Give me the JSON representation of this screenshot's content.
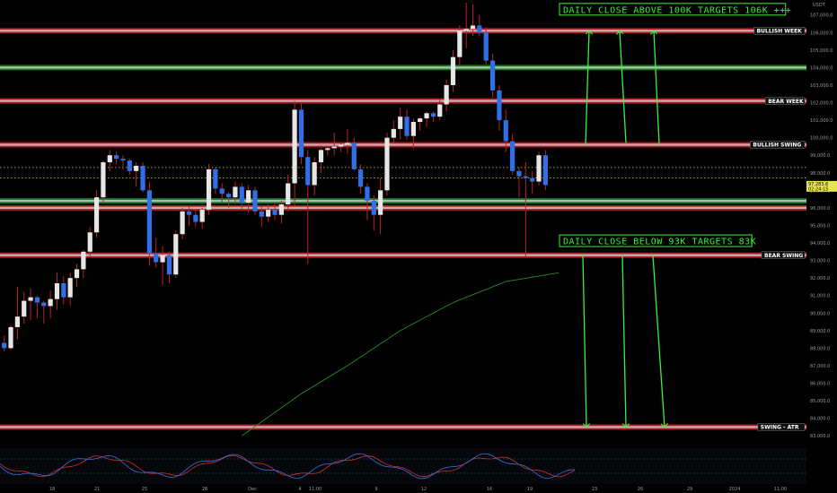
{
  "chart_data": {
    "type": "candlestick",
    "symbol_axis_label": "USDT",
    "colors": {
      "up": "#e6e6e6",
      "down": "#2f6fe8",
      "level_red": "#c8232a",
      "level_green": "#1f8a2a",
      "annotation": "#3cf03c",
      "ma": "#2a8a2a"
    },
    "y_axis": {
      "min": 82500,
      "max": 107700,
      "ticks": [
        83000,
        84000,
        85000,
        86000,
        87000,
        88000,
        89000,
        90000,
        91000,
        92000,
        93000,
        94000,
        95000,
        96000,
        97000,
        98000,
        99000,
        100000,
        101000,
        102000,
        103000,
        104000,
        105000,
        106000,
        107000
      ],
      "tick_labels": [
        "83,000.0",
        "84,000.0",
        "85,000.0",
        "86,000.0",
        "87,000.0",
        "88,000.0",
        "89,000.0",
        "90,000.0",
        "91,000.0",
        "92,000.0",
        "93,000.0",
        "94,000.0",
        "95,000.0",
        "96,000.0",
        "97,000.0",
        "98,000.0",
        "99,000.0",
        "100,000.0",
        "101,000.0",
        "102,000.0",
        "103,000.0",
        "104,000.0",
        "105,000.0",
        "106,000.0",
        "107,000.0"
      ]
    },
    "x_axis_labels": [
      "18",
      "21",
      "25",
      "28",
      "Dec",
      "4",
      "11:00",
      "9",
      "12",
      "16",
      "19",
      "23",
      "26",
      "29",
      "2024",
      "11:00"
    ],
    "levels": [
      {
        "label": "BULLISH WEEK",
        "price": 106100,
        "style": "red"
      },
      {
        "label": "",
        "price": 104000,
        "style": "green"
      },
      {
        "label": "BEAR WEEK",
        "price": 102100,
        "style": "red"
      },
      {
        "label": "BULLISH SWING",
        "price": 99600,
        "style": "red"
      },
      {
        "label": "",
        "price": 96400,
        "style": "green"
      },
      {
        "label": "",
        "price": 96000,
        "style": "red"
      },
      {
        "label": "BEAR SWING",
        "price": 93300,
        "style": "red"
      },
      {
        "label": "SWING - ATR",
        "price": 83500,
        "style": "red"
      }
    ],
    "dotted_levels": [
      98300,
      97700
    ],
    "current_price": {
      "value_label": "97,283.6",
      "countdown": "02:24:15",
      "price": 97280
    },
    "annotations": [
      {
        "text": "DAILY CLOSE ABOVE 100K TARGETS 106K +++",
        "price": 107300
      },
      {
        "text": "DAILY CLOSE BELOW 93K TARGETS 83K",
        "price": 94100
      }
    ],
    "candles": [
      [
        88300,
        88700,
        87800,
        88000
      ],
      [
        88000,
        89300,
        87900,
        89200
      ],
      [
        89200,
        91500,
        88500,
        89800
      ],
      [
        89800,
        91200,
        89400,
        90700
      ],
      [
        90700,
        91400,
        89600,
        90900
      ],
      [
        90900,
        91000,
        89700,
        90600
      ],
      [
        90600,
        90700,
        89400,
        90400
      ],
      [
        90400,
        91300,
        89700,
        90800
      ],
      [
        90800,
        92300,
        90200,
        91700
      ],
      [
        91700,
        92100,
        90500,
        90900
      ],
      [
        90900,
        92300,
        90400,
        92000
      ],
      [
        92000,
        92800,
        91500,
        92500
      ],
      [
        92500,
        93600,
        92000,
        93500
      ],
      [
        93500,
        94900,
        93200,
        94600
      ],
      [
        94600,
        97000,
        94300,
        96600
      ],
      [
        96600,
        98700,
        96300,
        98600
      ],
      [
        98600,
        99300,
        98100,
        99000
      ],
      [
        99000,
        99200,
        98500,
        98800
      ],
      [
        98800,
        99000,
        98200,
        98700
      ],
      [
        98700,
        98800,
        97900,
        98100
      ],
      [
        98100,
        98600,
        97200,
        98400
      ],
      [
        98400,
        98600,
        96900,
        97000
      ],
      [
        97000,
        97500,
        92700,
        93400
      ],
      [
        93400,
        94300,
        92600,
        92900
      ],
      [
        92900,
        93800,
        91600,
        93300
      ],
      [
        93300,
        93500,
        91700,
        92200
      ],
      [
        92200,
        94700,
        92000,
        94500
      ],
      [
        94500,
        96000,
        94200,
        95800
      ],
      [
        95800,
        96100,
        95000,
        95600
      ],
      [
        95600,
        95900,
        94900,
        95200
      ],
      [
        95200,
        96000,
        94800,
        95900
      ],
      [
        95900,
        98500,
        95600,
        98200
      ],
      [
        98200,
        98300,
        96800,
        97100
      ],
      [
        97100,
        97400,
        96300,
        96800
      ],
      [
        96800,
        96900,
        96000,
        96600
      ],
      [
        96600,
        97500,
        96200,
        97200
      ],
      [
        97200,
        97400,
        95900,
        96300
      ],
      [
        96300,
        97300,
        95700,
        97000
      ],
      [
        97000,
        97200,
        95600,
        95800
      ],
      [
        95800,
        96100,
        94900,
        95500
      ],
      [
        95500,
        96200,
        95200,
        95900
      ],
      [
        95900,
        96300,
        95300,
        95600
      ],
      [
        95600,
        96400,
        95100,
        96200
      ],
      [
        96200,
        97900,
        95800,
        97400
      ],
      [
        97400,
        102100,
        96100,
        101600
      ],
      [
        101600,
        102000,
        98500,
        98900
      ],
      [
        98900,
        99300,
        92800,
        97300
      ],
      [
        97300,
        98900,
        96700,
        98600
      ],
      [
        98600,
        99400,
        98000,
        99300
      ],
      [
        99300,
        99500,
        99000,
        99400
      ],
      [
        99400,
        100300,
        99000,
        99500
      ],
      [
        99500,
        99700,
        99200,
        99600
      ],
      [
        99600,
        100500,
        99100,
        99700
      ],
      [
        99700,
        100000,
        98100,
        98200
      ],
      [
        98200,
        98500,
        96800,
        97200
      ],
      [
        97200,
        97400,
        95300,
        96400
      ],
      [
        96400,
        96700,
        94700,
        95600
      ],
      [
        95600,
        97700,
        94500,
        97000
      ],
      [
        97000,
        100300,
        96700,
        100000
      ],
      [
        100000,
        101000,
        99700,
        100500
      ],
      [
        100500,
        101700,
        99900,
        101200
      ],
      [
        101200,
        101600,
        99900,
        100100
      ],
      [
        100100,
        101100,
        99400,
        100900
      ],
      [
        100900,
        101200,
        100400,
        101100
      ],
      [
        101100,
        101500,
        100600,
        101400
      ],
      [
        101400,
        101500,
        100900,
        101200
      ],
      [
        101200,
        102200,
        101000,
        101900
      ],
      [
        101900,
        103300,
        101500,
        103000
      ],
      [
        103000,
        105000,
        102600,
        104600
      ],
      [
        104600,
        106400,
        104100,
        106100
      ],
      [
        106100,
        107700,
        105100,
        106200
      ],
      [
        106200,
        107600,
        105800,
        106400
      ],
      [
        106400,
        107000,
        105800,
        106000
      ],
      [
        106000,
        106300,
        104200,
        104400
      ],
      [
        104400,
        104800,
        102300,
        102700
      ],
      [
        102700,
        103000,
        100400,
        101000
      ],
      [
        101000,
        101600,
        99200,
        99800
      ],
      [
        99800,
        100200,
        97900,
        98100
      ],
      [
        98100,
        98300,
        96600,
        97800
      ],
      [
        97800,
        98600,
        93200,
        97700
      ],
      [
        97700,
        98100,
        96800,
        97500
      ],
      [
        97500,
        99200,
        97300,
        99000
      ],
      [
        99000,
        99300,
        97000,
        97300
      ]
    ],
    "ma_line": [
      [
        36,
        83000
      ],
      [
        45,
        85400
      ],
      [
        52,
        87000
      ],
      [
        60,
        89000
      ],
      [
        68,
        90600
      ],
      [
        76,
        91800
      ],
      [
        84,
        92300
      ]
    ],
    "oscillator": {
      "levels": [
        80,
        20
      ]
    }
  }
}
